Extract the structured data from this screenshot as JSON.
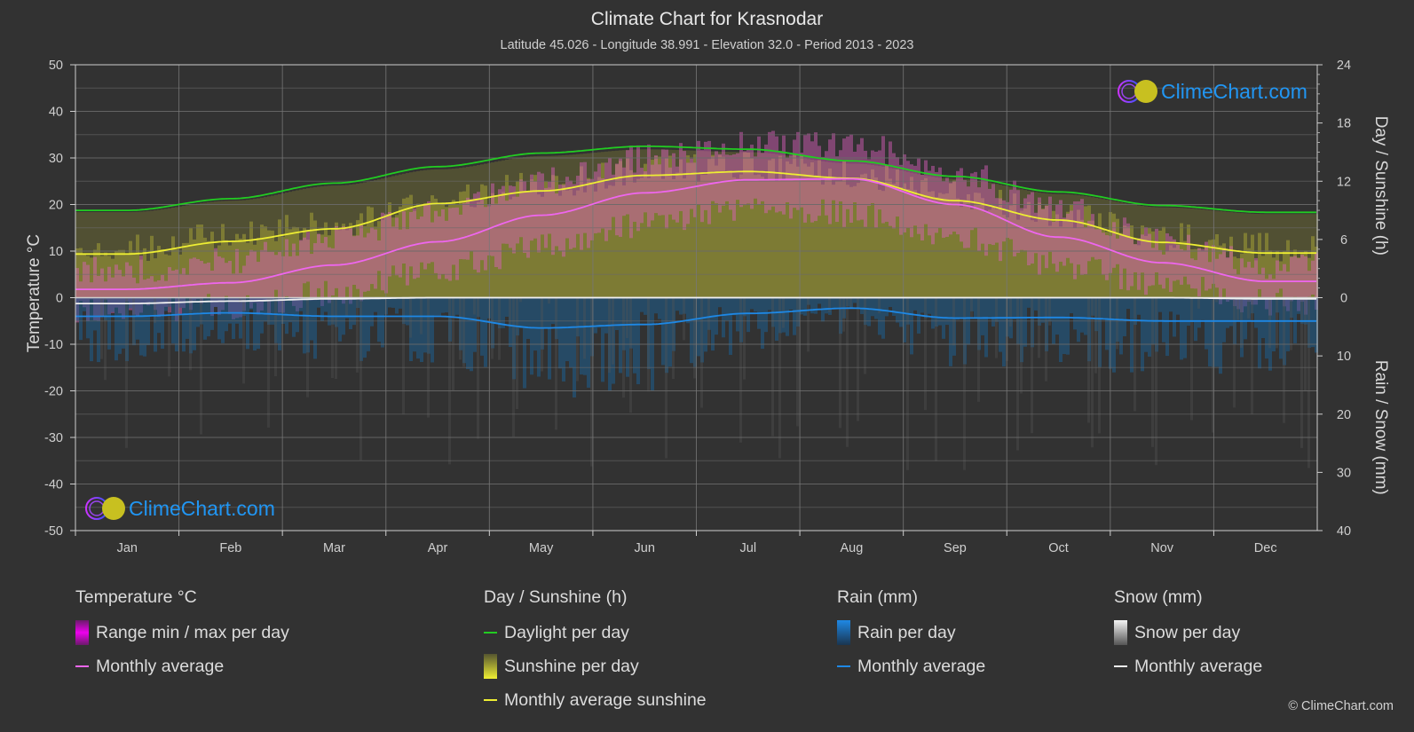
{
  "title": "Climate Chart for Krasnodar",
  "subtitle": "Latitude 45.026 - Longitude 38.991 - Elevation 32.0 - Period 2013 - 2023",
  "logo_text": "ClimeChart.com",
  "copyright": "© ClimeChart.com",
  "colors": {
    "background": "#323232",
    "temp_avg": "#ee66ee",
    "temp_range": "#d020d0",
    "daylight": "#22cc22",
    "sunshine_avg": "#eeee33",
    "sunshine_fill": "#8c8a36",
    "rain_avg": "#1e88e5",
    "rain_fill": "#1e5f8f",
    "snow_avg": "#f0f0f0",
    "snow_fill": "#777777"
  },
  "chart_data": {
    "type": "area",
    "title": "Climate Chart for Krasnodar",
    "categories": [
      "Jan",
      "Feb",
      "Mar",
      "Apr",
      "May",
      "Jun",
      "Jul",
      "Aug",
      "Sep",
      "Oct",
      "Nov",
      "Dec"
    ],
    "left_axis": {
      "label": "Temperature °C",
      "range": [
        -50,
        50
      ],
      "ticks": [
        50,
        40,
        30,
        20,
        10,
        0,
        -10,
        -20,
        -30,
        -40,
        -50
      ]
    },
    "right_axis_top": {
      "label": "Day / Sunshine (h)",
      "range": [
        0,
        24
      ],
      "ticks": [
        24,
        18,
        12,
        6,
        0
      ]
    },
    "right_axis_bottom": {
      "label": "Rain / Snow (mm)",
      "range": [
        0,
        40
      ],
      "ticks": [
        0,
        10,
        20,
        30,
        40
      ]
    },
    "grid": true,
    "series": [
      {
        "name": "Temperature monthly average",
        "axis": "temperature",
        "values": [
          1.8,
          3.2,
          7.0,
          12.0,
          17.7,
          22.5,
          25.3,
          25.5,
          20.0,
          13.0,
          7.5,
          3.5
        ]
      },
      {
        "name": "Temperature daily max (approx.)",
        "axis": "temperature",
        "values": [
          6,
          8,
          13,
          19,
          25,
          30,
          33,
          33,
          27,
          19,
          12,
          7
        ]
      },
      {
        "name": "Temperature daily min (approx.)",
        "axis": "temperature",
        "values": [
          -3,
          -2,
          1,
          6,
          11,
          16,
          19,
          18,
          13,
          7,
          3,
          -1
        ]
      },
      {
        "name": "Daylight per day",
        "axis": "hours",
        "values": [
          9.0,
          10.2,
          11.8,
          13.5,
          14.9,
          15.6,
          15.3,
          14.1,
          12.5,
          10.9,
          9.5,
          8.8
        ]
      },
      {
        "name": "Monthly average sunshine",
        "axis": "hours",
        "values": [
          4.5,
          5.8,
          7.1,
          9.7,
          11.0,
          12.6,
          13.0,
          12.3,
          10.0,
          8.0,
          5.7,
          4.6
        ]
      },
      {
        "name": "Rain monthly average",
        "axis": "mm",
        "values": [
          3.2,
          2.6,
          3.2,
          3.2,
          5.2,
          4.6,
          2.7,
          1.8,
          3.5,
          3.4,
          4.0,
          4.0
        ]
      },
      {
        "name": "Snow monthly average",
        "axis": "mm",
        "values": [
          1.0,
          0.6,
          0.2,
          0,
          0,
          0,
          0,
          0,
          0,
          0,
          0,
          0.2
        ]
      }
    ]
  },
  "legend": {
    "temperature": {
      "title": "Temperature °C",
      "items": [
        "Range min / max per day",
        "Monthly average"
      ]
    },
    "sunshine": {
      "title": "Day / Sunshine (h)",
      "items": [
        "Daylight per day",
        "Sunshine per day",
        "Monthly average sunshine"
      ]
    },
    "rain": {
      "title": "Rain (mm)",
      "items": [
        "Rain per day",
        "Monthly average"
      ]
    },
    "snow": {
      "title": "Snow (mm)",
      "items": [
        "Snow per day",
        "Monthly average"
      ]
    }
  }
}
